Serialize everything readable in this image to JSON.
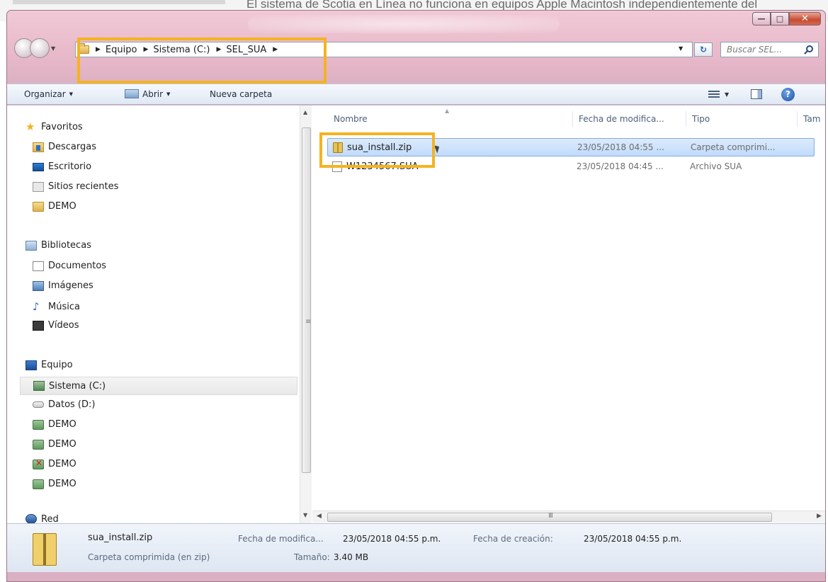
{
  "background_caption": "El sistema de Scotia en Línea no funciona en equipos Apple Macintosh independientemente del",
  "window": {
    "caption_buttons": {
      "minimize": "—",
      "maximize": "□",
      "close": "✕"
    }
  },
  "address_bar": {
    "crumbs": [
      "Equipo",
      "Sistema (C:)",
      "SEL_SUA"
    ],
    "search_placeholder": "Buscar SEL..."
  },
  "toolbar": {
    "organize_label": "Organizar",
    "open_label": "Abrir",
    "new_folder_label": "Nueva carpeta"
  },
  "nav_pane": {
    "favorites_header": "Favoritos",
    "favorites": [
      "Descargas",
      "Escritorio",
      "Sitios recientes",
      "DEMO"
    ],
    "libraries_header": "Bibliotecas",
    "libraries": [
      "Documentos",
      "Imágenes",
      "Música",
      "Vídeos"
    ],
    "computer_header": "Equipo",
    "computer": [
      "Sistema (C:)",
      "Datos (D:)",
      "DEMO",
      "DEMO",
      "DEMO",
      "DEMO"
    ],
    "network_header": "Red"
  },
  "file_list": {
    "columns": [
      "Nombre",
      "Fecha de modifica...",
      "Tipo",
      "Tam"
    ],
    "rows": [
      {
        "name": "sua_install.zip",
        "date": "23/05/2018 04:55 ...",
        "type": "Carpeta comprimi...",
        "selected": true
      },
      {
        "name": "W1234567.SUA",
        "date": "23/05/2018 04:45 ...",
        "type": "Archivo SUA",
        "selected": false
      }
    ],
    "hscroll_grip": "III"
  },
  "details_pane": {
    "file_name": "sua_install.zip",
    "file_type": "Carpeta comprimida (en zip)",
    "modified_label": "Fecha de modifica...",
    "modified_value": "23/05/2018 04:55 p.m.",
    "created_label": "Fecha de creación:",
    "created_value": "23/05/2018 04:55 p.m.",
    "size_label": "Tamaño:",
    "size_value": "3.40 MB"
  },
  "colors": {
    "highlight": "#f5b321",
    "window_frame": "#e6b7c8",
    "selection": "#c1dbfc"
  }
}
